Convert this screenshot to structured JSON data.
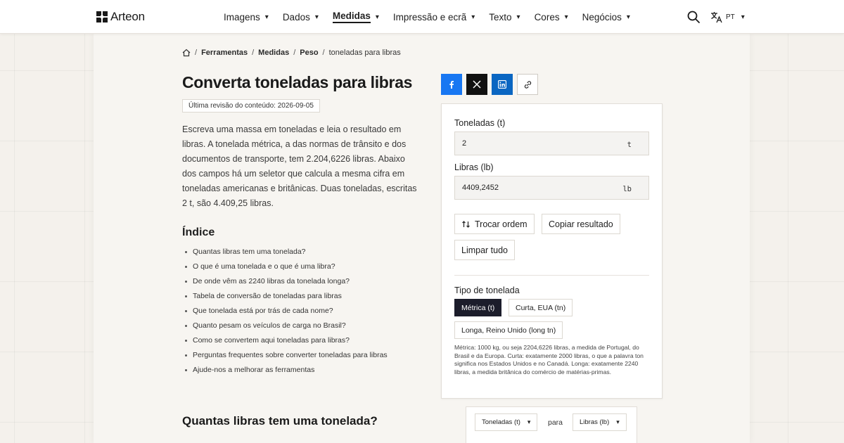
{
  "brand": {
    "name": "Arteon"
  },
  "nav": {
    "items": [
      {
        "label": "Imagens",
        "active": false
      },
      {
        "label": "Dados",
        "active": false
      },
      {
        "label": "Medidas",
        "active": true
      },
      {
        "label": "Impressão e ecrã",
        "active": false
      },
      {
        "label": "Texto",
        "active": false
      },
      {
        "label": "Cores",
        "active": false
      },
      {
        "label": "Negócios",
        "active": false
      }
    ],
    "caret": "▾",
    "search_icon": "search-icon",
    "language": {
      "code": "PT",
      "icon": "translate-icon"
    }
  },
  "breadcrumb": {
    "home_icon": "home-icon",
    "separator": "/",
    "items": [
      "Ferramentas",
      "Medidas",
      "Peso"
    ],
    "current": "toneladas para libras"
  },
  "page": {
    "title": "Converta toneladas para libras",
    "revised": "Última revisão do conteúdo: 2026-09-05",
    "intro": "Escreva uma massa em toneladas e leia o resultado em libras. A tonelada métrica, a das normas de trânsito e dos documentos de transporte, tem 2.204,6226 libras. Abaixo dos campos há um seletor que calcula a mesma cifra em toneladas americanas e britânicas. Duas toneladas, escritas 2 t, são 4.409,25 libras."
  },
  "toc": {
    "title": "Índice",
    "items": [
      "Quantas libras tem uma tonelada?",
      "O que é uma tonelada e o que é uma libra?",
      "De onde vêm as 2240 libras da tonelada longa?",
      "Tabela de conversão de toneladas para libras",
      "Que tonelada está por trás de cada nome?",
      "Quanto pesam os veículos de carga no Brasil?",
      "Como se convertem aqui toneladas para libras?",
      "Perguntas frequentes sobre converter toneladas para libras",
      "Ajude-nos a melhorar as ferramentas"
    ]
  },
  "section": {
    "heading": "Quantas libras tem uma tonelada?"
  },
  "share": {
    "buttons": [
      {
        "network": "facebook",
        "icon": "facebook-icon",
        "color": "#1877f2"
      },
      {
        "network": "x",
        "icon": "x-icon",
        "color": "#111111"
      },
      {
        "network": "linkedin",
        "icon": "linkedin-icon",
        "color": "#0a66c2"
      },
      {
        "network": "link",
        "icon": "link-icon",
        "color": "#ffffff"
      }
    ]
  },
  "converter": {
    "from": {
      "label": "Toneladas (t)",
      "value": "2",
      "unit": "t"
    },
    "to": {
      "label": "Libras (lb)",
      "value": "4409,2452",
      "unit": "lb"
    },
    "buttons": {
      "swap": "Trocar ordem",
      "swap_icon": "swap-arrows-icon",
      "copy": "Copiar resultado",
      "clear": "Limpar tudo"
    },
    "ton_type": {
      "label": "Tipo de tonelada",
      "options": [
        {
          "label": "Métrica (t)",
          "selected": true
        },
        {
          "label": "Curta, EUA (tn)",
          "selected": false
        },
        {
          "label": "Longa, Reino Unido (long tn)",
          "selected": false
        }
      ],
      "note": "Métrica: 1000 kg, ou seja 2204,6226 libras, a medida de Portugal, do Brasil e da Europa. Curta: exatamente 2000 libras, o que a palavra ton significa nos Estados Unidos e no Canadá. Longa: exatamente 2240 libras, a medida britânica do comércio de matérias-primas."
    }
  },
  "mini_selector": {
    "from": "Toneladas (t)",
    "connector": "para",
    "to": "Libras (lb)"
  },
  "colors": {
    "accent_dark": "#1c1d2b",
    "background": "#f4f1ec",
    "sheet": "#f7f5f1"
  }
}
